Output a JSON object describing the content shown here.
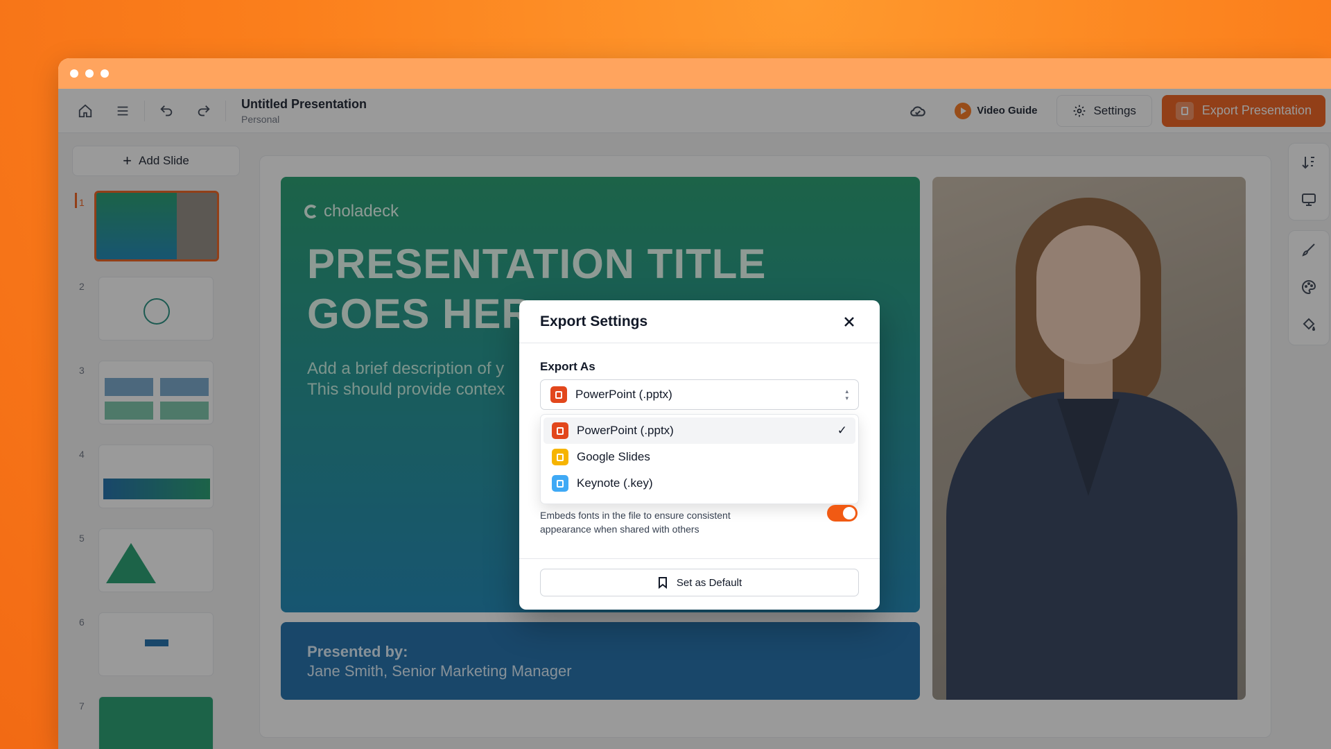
{
  "app": {
    "title": "Untitled Presentation",
    "workspace": "Personal"
  },
  "toolbar": {
    "video_guide": "Video Guide",
    "settings": "Settings",
    "export": "Export Presentation"
  },
  "sidebar": {
    "add_slide": "Add Slide",
    "slides": [
      "1",
      "2",
      "3",
      "4",
      "5",
      "6",
      "7"
    ]
  },
  "slide": {
    "logo": "choladeck",
    "title_line1": "PRESENTATION TITLE",
    "title_line2": "GOES HER",
    "desc_line1": "Add a brief description of y",
    "desc_line2": "This should provide contex",
    "presented_by": "Presented by:",
    "presenter": "Jane Smith, Senior Marketing Manager"
  },
  "modal": {
    "title": "Export Settings",
    "export_as_label": "Export As",
    "selected": "PowerPoint (.pptx)",
    "options": [
      {
        "label": "PowerPoint (.pptx)",
        "icon": "powerpoint-icon",
        "selected": true
      },
      {
        "label": "Google Slides",
        "icon": "google-slides-icon",
        "selected": false
      },
      {
        "label": "Keynote (.key)",
        "icon": "keynote-icon",
        "selected": false
      }
    ],
    "embed_description": "Embeds fonts in the file to ensure consistent appearance when shared with others",
    "embed_enabled": true,
    "set_default": "Set as Default"
  },
  "colors": {
    "accent": "#f15a13",
    "background": "#fb7f1c"
  }
}
